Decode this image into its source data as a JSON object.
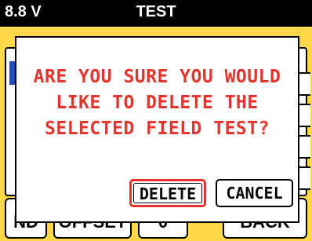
{
  "header": {
    "voltage": "8.8 V",
    "title": "TEST"
  },
  "background_buttons": {
    "left": "ND",
    "offset": "OFFSET",
    "zero": "0",
    "back": "BACK"
  },
  "dialog": {
    "message_line1": "ARE YOU SURE YOU WOULD",
    "message_line2": "LIKE TO DELETE THE",
    "message_line3": "SELECTED FIELD TEST?",
    "delete_label": "DELETE",
    "cancel_label": "CANCEL"
  },
  "colors": {
    "background": "#ffd84a",
    "header": "#000000",
    "message_text": "#e8332d",
    "selection": "#1f4db8"
  }
}
